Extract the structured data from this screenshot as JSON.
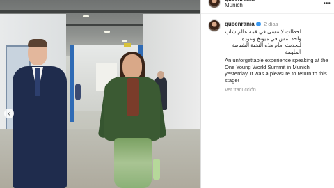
{
  "header": {
    "username": "queenrania",
    "location": "Múnich",
    "more_icon": "more-horizontal-icon"
  },
  "post": {
    "username": "queenrania",
    "verified": true,
    "time": "2 días",
    "arabic_caption": "لحظات لا تنسى في قمة عالم شاب واحد أمس في ميونخ وعودة للحديث امام هذه النخبة الشبابية الملهمة",
    "caption": "An unforgettable experience speaking at the One Young World Summit in Munich yesterday. It was a pleasure to return to this stage!",
    "translate_label": "Ver traducción"
  },
  "photo": {
    "prev_icon": "chevron-left-icon"
  },
  "colors": {
    "verified_blue": "#3897f0",
    "text_primary": "#262626",
    "text_secondary": "#8e8e8e"
  }
}
